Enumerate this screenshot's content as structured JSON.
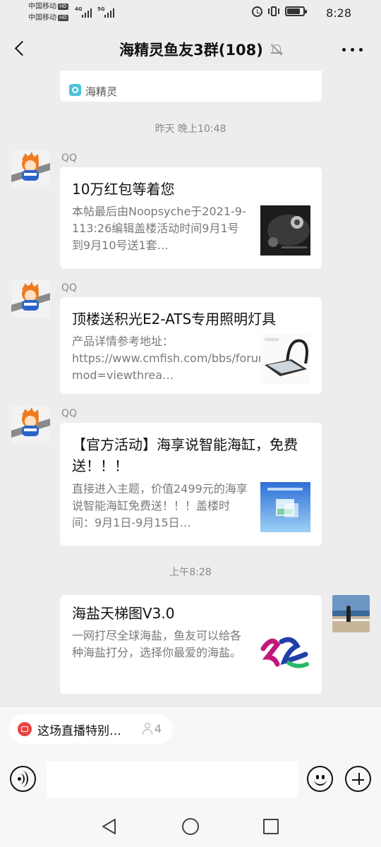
{
  "status_bar": {
    "carrier1": "中国移动",
    "carrier2": "中国移动",
    "hd": "HD",
    "net1": "4G",
    "net2": "5G",
    "time": "8:28"
  },
  "header": {
    "title": "海精灵鱼友3群(108)"
  },
  "chat": {
    "top_card_source": "海精灵",
    "separator1": "昨天 晚上10:48",
    "separator2": "上午8:28",
    "messages": [
      {
        "sender": "QQ",
        "title": "10万红包等着您",
        "desc": "本帖最后由Noopsyche于2021-9-113:26编辑盖楼活动时间9月1号到9月10号送1套…"
      },
      {
        "sender": "QQ",
        "title": "顶楼送积光E2-ATS专用照明灯具",
        "desc": "产品详情参考地址：https://www.cmfish.com/bbs/forum.php?mod=viewthrea…"
      },
      {
        "sender": "QQ",
        "title": "【官方活动】海享说智能海缸，免费送！！！",
        "desc": "直接进入主题，价值2499元的海享说智能海缸免费送！！！盖楼时间：9月1日-9月15日…"
      },
      {
        "sender": "",
        "title": "海盐天梯图V3.0",
        "desc": "一网打尽全球海盐，鱼友可以给各种海盐打分，选择你最爱的海盐。"
      }
    ]
  },
  "live": {
    "text": "这场直播特别…",
    "count": "4"
  },
  "input": {
    "placeholder": ""
  }
}
